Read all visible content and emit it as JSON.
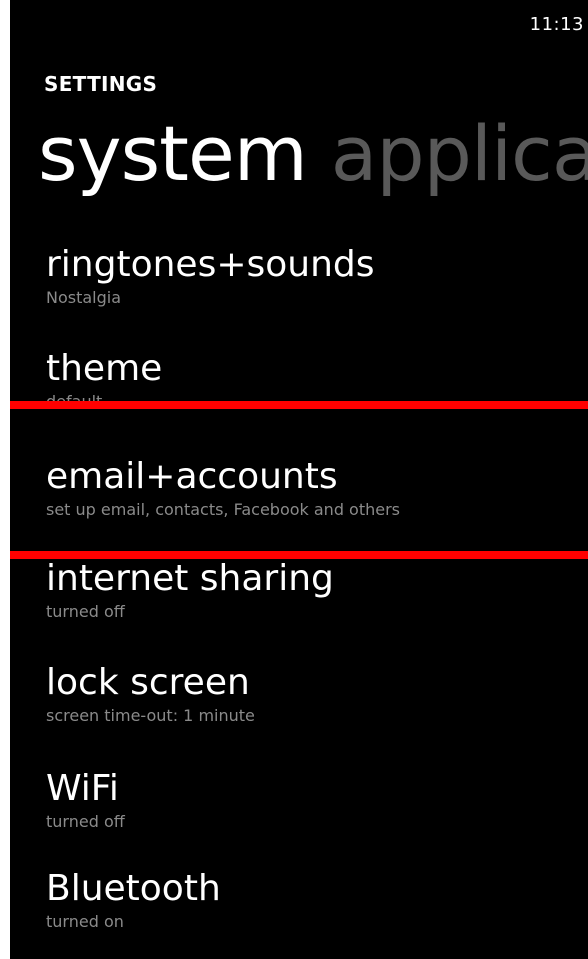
{
  "status_bar": {
    "time": "11:13"
  },
  "header": {
    "title": "SETTINGS"
  },
  "pivot": {
    "tabs": [
      {
        "label": "system",
        "active": true
      },
      {
        "label": "applica",
        "active": false
      }
    ]
  },
  "settings": {
    "items": [
      {
        "title": "ringtones+sounds",
        "subtitle": "Nostalgia"
      },
      {
        "title": "theme",
        "subtitle": "default"
      },
      {
        "title": "email+accounts",
        "subtitle": "set up email, contacts, Facebook and others"
      },
      {
        "title": "internet sharing",
        "subtitle": "turned off"
      },
      {
        "title": "lock screen",
        "subtitle": "screen time-out: 1 minute"
      },
      {
        "title": "WiFi",
        "subtitle": "turned off"
      },
      {
        "title": "Bluetooth",
        "subtitle": "turned on"
      }
    ]
  },
  "colors": {
    "background": "#000000",
    "primary_text": "#ffffff",
    "secondary_text": "#8a8a8a",
    "inactive_pivot": "#595959",
    "highlight_lines": "#ff0000"
  }
}
